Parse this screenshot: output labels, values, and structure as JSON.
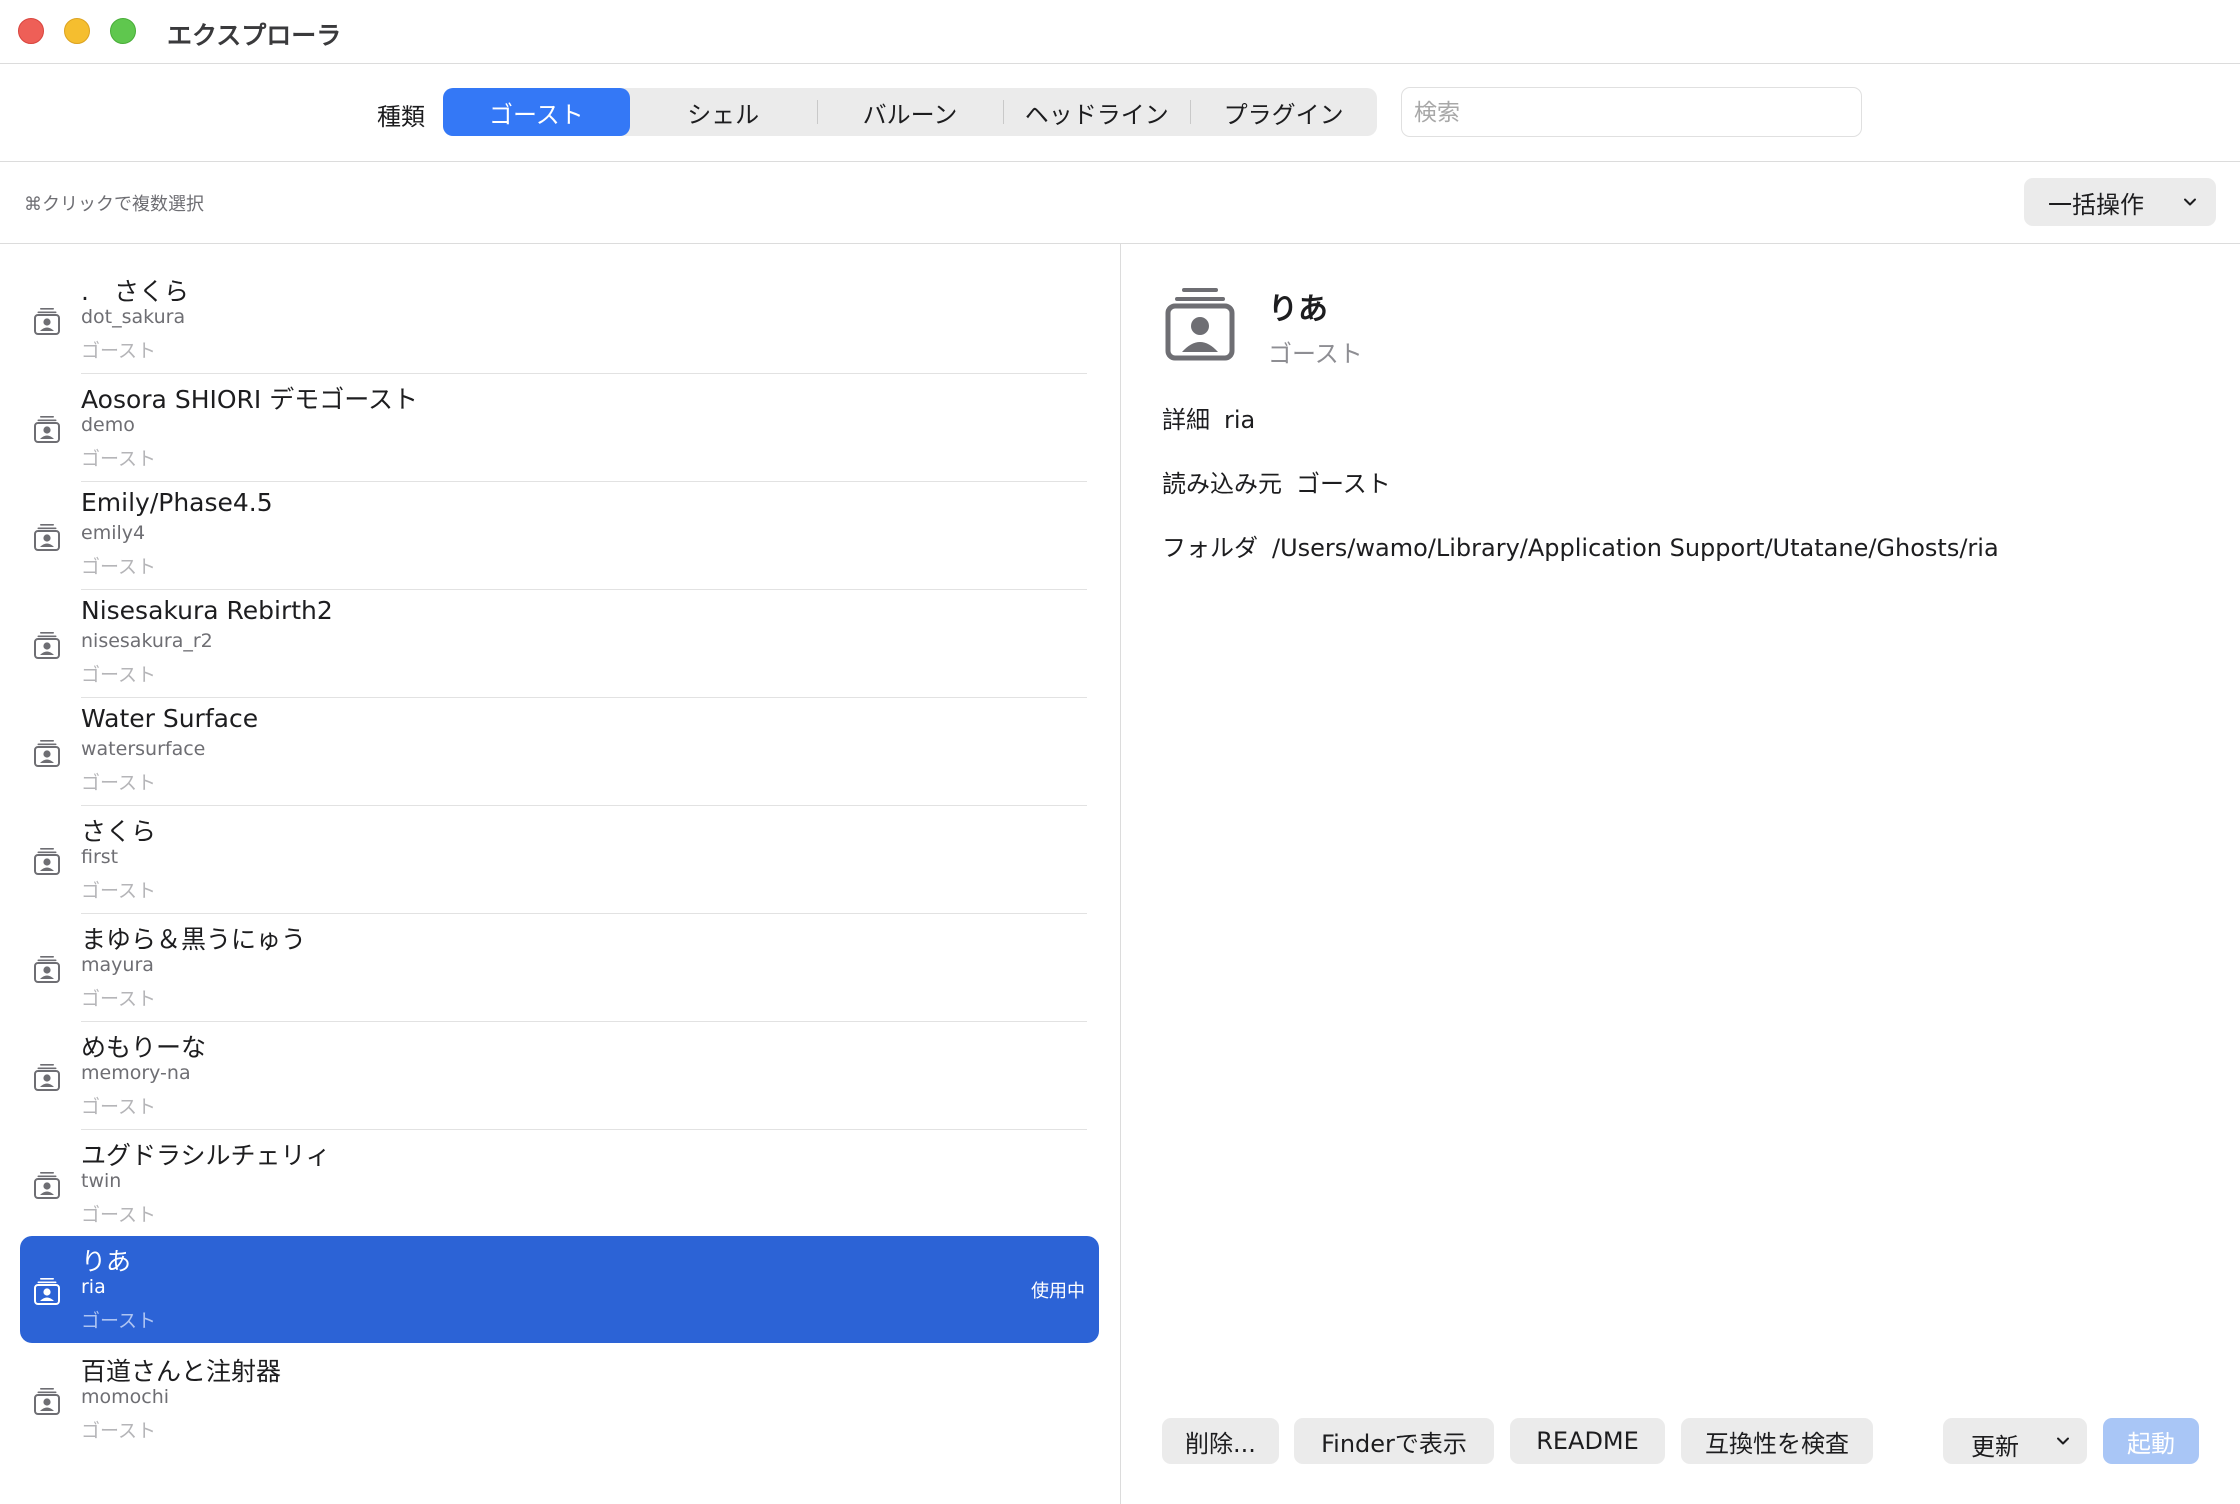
{
  "window": {
    "title": "エクスプローラ"
  },
  "toolbar": {
    "kind_label": "種類",
    "segments": [
      "ゴースト",
      "シェル",
      "バルーン",
      "ヘッドライン",
      "プラグイン"
    ],
    "active_segment": "ゴースト",
    "search_placeholder": "検索"
  },
  "subbar": {
    "hint": "⌘クリックで複数選択",
    "bulk_label": "一括操作"
  },
  "list": {
    "items": [
      {
        "name": ".　さくら",
        "id": "dot_sakura",
        "type": "ゴースト",
        "badge": ""
      },
      {
        "name": "Aosora SHIORI デモゴースト",
        "id": "demo",
        "type": "ゴースト",
        "badge": ""
      },
      {
        "name": "Emily/Phase4.5",
        "id": "emily4",
        "type": "ゴースト",
        "badge": ""
      },
      {
        "name": "Nisesakura Rebirth2",
        "id": "nisesakura_r2",
        "type": "ゴースト",
        "badge": ""
      },
      {
        "name": "Water Surface",
        "id": "watersurface",
        "type": "ゴースト",
        "badge": ""
      },
      {
        "name": "さくら",
        "id": "first",
        "type": "ゴースト",
        "badge": ""
      },
      {
        "name": "まゆら＆黒うにゅう",
        "id": "mayura",
        "type": "ゴースト",
        "badge": ""
      },
      {
        "name": "めもりーな",
        "id": "memory-na",
        "type": "ゴースト",
        "badge": ""
      },
      {
        "name": "ユグドラシルチェリィ",
        "id": "twin",
        "type": "ゴースト",
        "badge": ""
      },
      {
        "name": "りあ",
        "id": "ria",
        "type": "ゴースト",
        "badge": "使用中",
        "selected": true
      },
      {
        "name": "百道さんと注射器",
        "id": "momochi",
        "type": "ゴースト",
        "badge": ""
      }
    ]
  },
  "detail": {
    "name": "りあ",
    "type": "ゴースト",
    "fields": [
      {
        "label": "詳細",
        "value": "ria"
      },
      {
        "label": "読み込み元",
        "value": "ゴースト"
      },
      {
        "label": "フォルダ",
        "value": "/Users/wamo/Library/Application Support/Utatane/Ghosts/ria"
      }
    ],
    "buttons": {
      "delete": "削除...",
      "finder": "Finderで表示",
      "readme": "README",
      "compat": "互換性を検査",
      "update": "更新",
      "launch": "起動"
    }
  },
  "colors": {
    "accent": "#3478f6",
    "selection": "#2c63d6",
    "launch_disabled": "#a9c6f6"
  },
  "icons": {
    "item": "ghost-card-icon",
    "dropdown": "chevron-down-icon"
  }
}
